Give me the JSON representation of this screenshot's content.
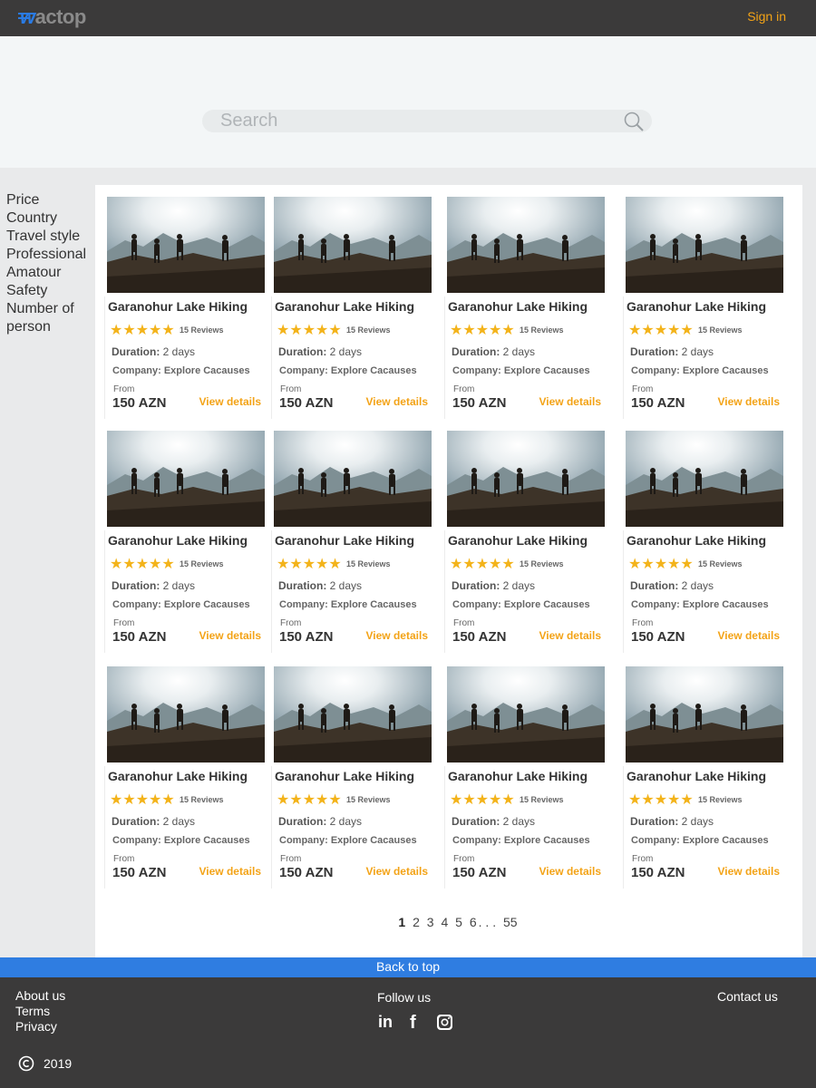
{
  "header": {
    "logo_mark": "w",
    "logo_rest": "actop",
    "signin_label": "Sign in",
    "accent": "#f3a317",
    "brand_blue": "#2a7be4"
  },
  "search": {
    "placeholder": "Search",
    "icon": "search-icon"
  },
  "filters": [
    "Price",
    "Country",
    "Travel style",
    "Professional",
    "Amatour",
    "Safety",
    "Number of person"
  ],
  "tours": [
    {
      "title": "Garanohur Lake Hiking",
      "rating": 5,
      "reviews": "15 Reviews",
      "duration_label": "Duration:",
      "duration": "2 days",
      "company": "Company: Explore Cacauses",
      "from_label": "From",
      "price": "150 AZN",
      "details_label": "View details"
    },
    {
      "title": "Garanohur Lake Hiking",
      "rating": 5,
      "reviews": "15 Reviews",
      "duration_label": "Duration:",
      "duration": "2 days",
      "company": "Company: Explore Cacauses",
      "from_label": "From",
      "price": "150 AZN",
      "details_label": "View details"
    },
    {
      "title": "Garanohur Lake Hiking",
      "rating": 5,
      "reviews": "15 Reviews",
      "duration_label": "Duration:",
      "duration": "2 days",
      "company": "Company: Explore Cacauses",
      "from_label": "From",
      "price": "150 AZN",
      "details_label": "View details"
    },
    {
      "title": "Garanohur Lake Hiking",
      "rating": 5,
      "reviews": "15 Reviews",
      "duration_label": "Duration:",
      "duration": "2 days",
      "company": "Company: Explore Cacauses",
      "from_label": "From",
      "price": "150 AZN",
      "details_label": "View details"
    },
    {
      "title": "Garanohur Lake Hiking",
      "rating": 5,
      "reviews": "15 Reviews",
      "duration_label": "Duration:",
      "duration": "2 days",
      "company": "Company: Explore Cacauses",
      "from_label": "From",
      "price": "150 AZN",
      "details_label": "View details"
    },
    {
      "title": "Garanohur Lake Hiking",
      "rating": 5,
      "reviews": "15 Reviews",
      "duration_label": "Duration:",
      "duration": "2 days",
      "company": "Company: Explore Cacauses",
      "from_label": "From",
      "price": "150 AZN",
      "details_label": "View details"
    },
    {
      "title": "Garanohur Lake Hiking",
      "rating": 5,
      "reviews": "15 Reviews",
      "duration_label": "Duration:",
      "duration": "2 days",
      "company": "Company: Explore Cacauses",
      "from_label": "From",
      "price": "150 AZN",
      "details_label": "View details"
    },
    {
      "title": "Garanohur Lake Hiking",
      "rating": 5,
      "reviews": "15 Reviews",
      "duration_label": "Duration:",
      "duration": "2 days",
      "company": "Company: Explore Cacauses",
      "from_label": "From",
      "price": "150 AZN",
      "details_label": "View details"
    },
    {
      "title": "Garanohur Lake Hiking",
      "rating": 5,
      "reviews": "15 Reviews",
      "duration_label": "Duration:",
      "duration": "2 days",
      "company": "Company: Explore Cacauses",
      "from_label": "From",
      "price": "150 AZN",
      "details_label": "View details"
    },
    {
      "title": "Garanohur Lake Hiking",
      "rating": 5,
      "reviews": "15 Reviews",
      "duration_label": "Duration:",
      "duration": "2 days",
      "company": "Company: Explore Cacauses",
      "from_label": "From",
      "price": "150 AZN",
      "details_label": "View details"
    },
    {
      "title": "Garanohur Lake Hiking",
      "rating": 5,
      "reviews": "15 Reviews",
      "duration_label": "Duration:",
      "duration": "2 days",
      "company": "Company: Explore Cacauses",
      "from_label": "From",
      "price": "150 AZN",
      "details_label": "View details"
    },
    {
      "title": "Garanohur Lake Hiking",
      "rating": 5,
      "reviews": "15 Reviews",
      "duration_label": "Duration:",
      "duration": "2 days",
      "company": "Company: Explore Cacauses",
      "from_label": "From",
      "price": "150 AZN",
      "details_label": "View details"
    }
  ],
  "pagination": {
    "current": "1",
    "pages": [
      "2",
      "3",
      "4",
      "5",
      "6"
    ],
    "ellipsis": ". . .",
    "last": "55"
  },
  "back_to_top": "Back to top",
  "footer": {
    "links": [
      "About us",
      "Terms",
      "Privacy"
    ],
    "follow_label": "Follow us",
    "social_icons": [
      "linkedin-icon",
      "facebook-icon",
      "instagram-icon"
    ],
    "contact_label": "Contact us",
    "year": "2019"
  }
}
